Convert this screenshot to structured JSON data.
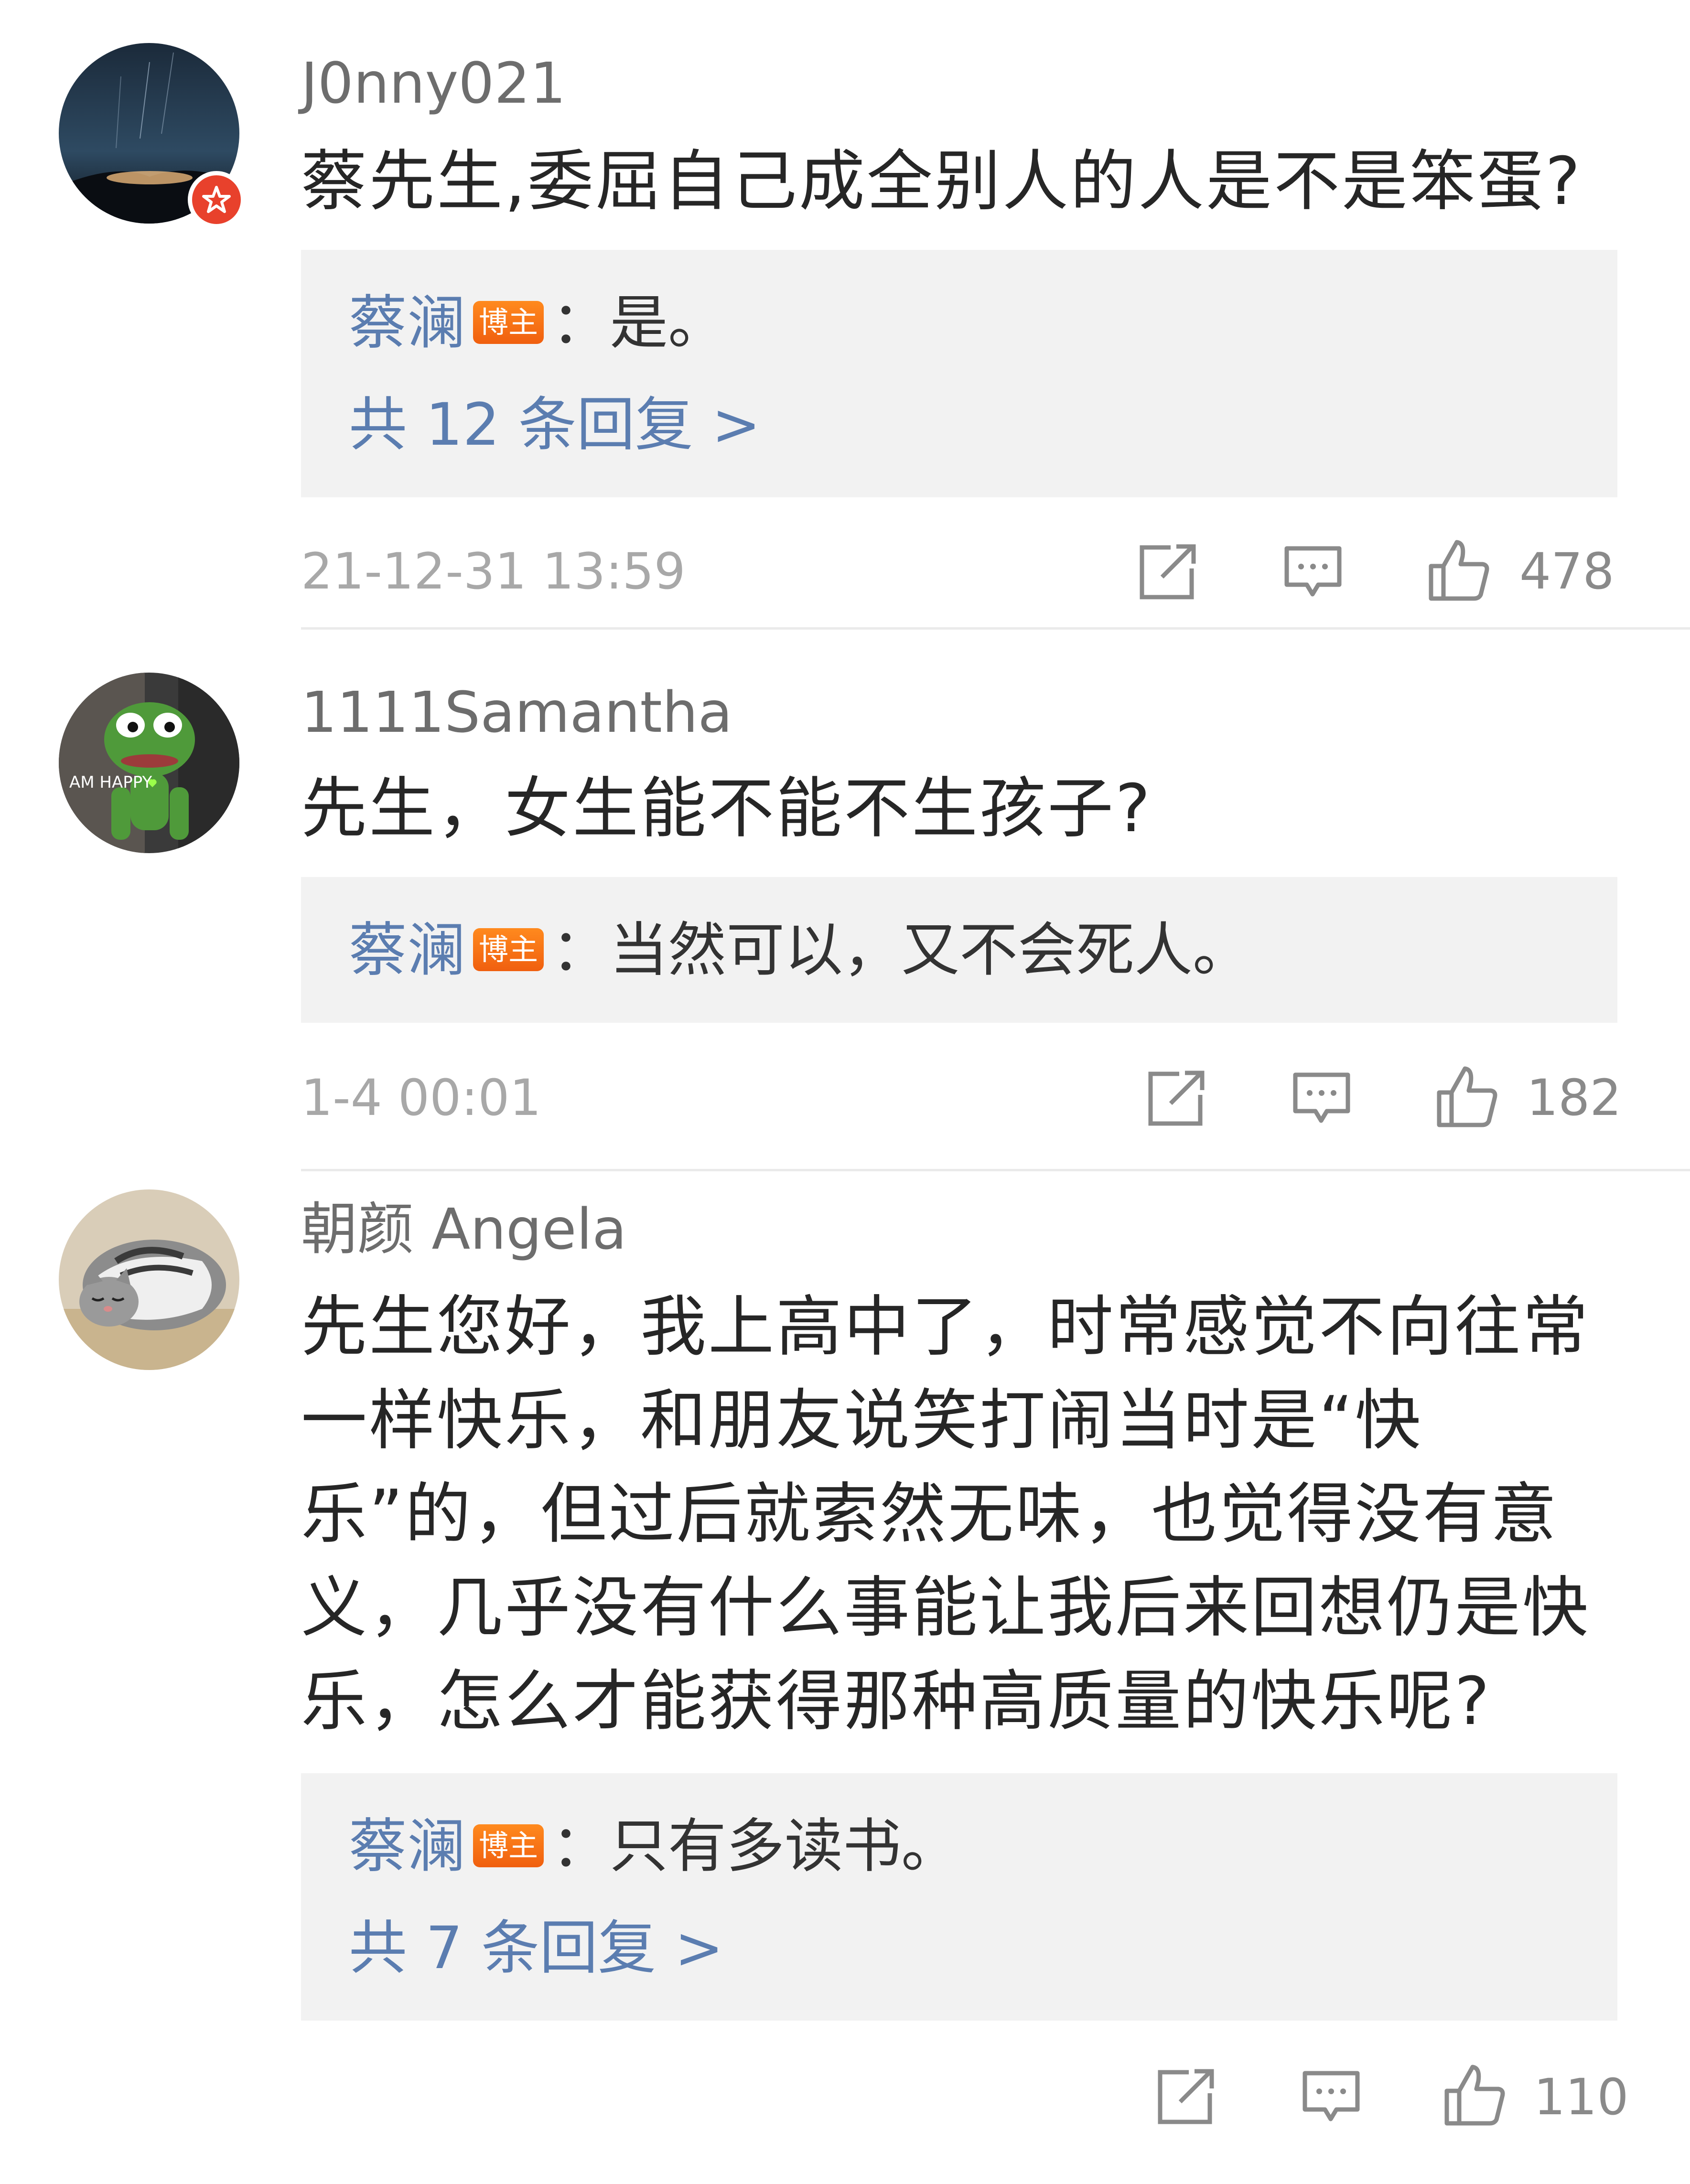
{
  "comments": [
    {
      "username": "J0nny021",
      "text": "蔡先生,委屈自己成全别人的人是不是笨蛋?",
      "reply": {
        "author": "蔡澜",
        "tag": "博主",
        "text": "：是。"
      },
      "more_replies": "共 12 条回复 >",
      "time": "21-12-31 13:59",
      "likes": "478",
      "avatar_icon": "night-sky-avatar",
      "badge_icon": "vip-star-badge"
    },
    {
      "username": "1111Samantha",
      "text": "先生，女生能不能不生孩子?",
      "reply": {
        "author": "蔡澜",
        "tag": "博主",
        "text": "：当然可以，又不会死人。"
      },
      "avatar_caption": "AM HAPPY",
      "time": "1-4 00:01",
      "likes": "182",
      "avatar_icon": "frog-plush-avatar"
    },
    {
      "username": "朝颜 Angela",
      "text": "先生您好，我上高中了，时常感觉不向往常一样快乐，和朋友说笑打闹当时是“快乐”的，但过后就索然无味，也觉得没有意义，几乎没有什么事能让我后来回想仍是快乐，怎么才能获得那种高质量的快乐呢?",
      "reply": {
        "author": "蔡澜",
        "tag": "博主",
        "text": "：只有多读书。"
      },
      "more_replies": "共 7 条回复 >",
      "time": "",
      "likes": "110",
      "avatar_icon": "sleeping-cat-avatar"
    }
  ],
  "colors": {
    "author_blue": "#5b7db0",
    "tag_orange": "#f36a12",
    "reply_bg": "#f2f2f2",
    "vip_red": "#e8412c"
  },
  "icons": [
    "share-icon",
    "comment-icon",
    "like-icon"
  ]
}
